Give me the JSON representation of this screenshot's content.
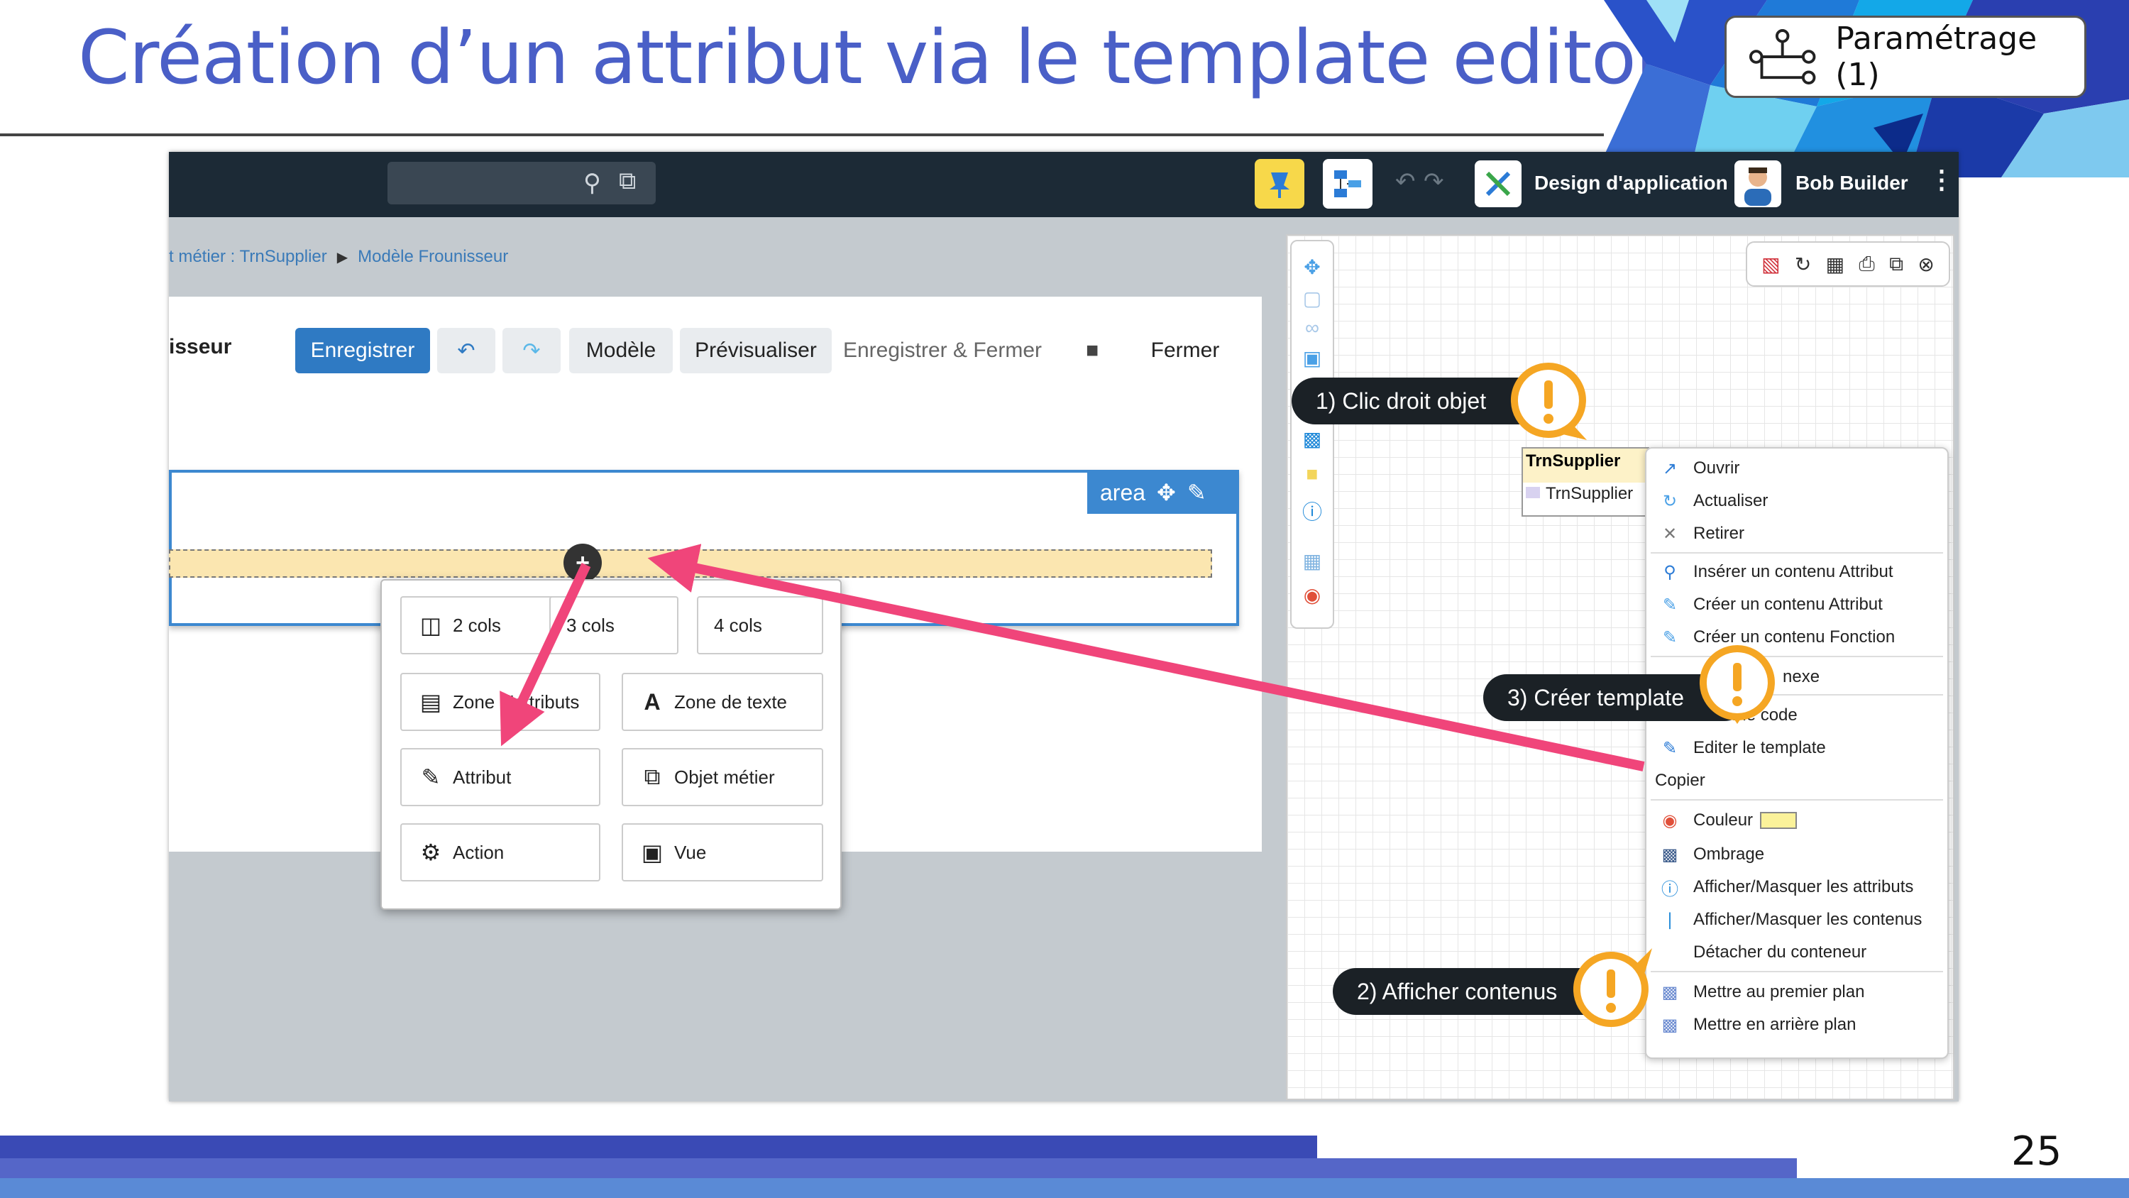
{
  "slide": {
    "title": "Création d’un attribut via le template editor",
    "badge_label": "Paramétrage (1)",
    "page_number": "25"
  },
  "app": {
    "topbar": {
      "app_label": "Design d'application",
      "user_name": "Bob Builder"
    },
    "breadcrumb": {
      "part1": "t métier : TrnSupplier",
      "separator": "▶",
      "part2": "Modèle Frounisseur"
    },
    "header_title": "isseur",
    "toolbar": {
      "save": "Enregistrer",
      "model": "Modèle",
      "preview": "Prévisualiser",
      "save_close": "Enregistrer & Fermer",
      "close": "Fermer"
    },
    "area_label": "area",
    "popup": {
      "items": [
        "2 cols",
        "3 cols",
        "4 cols",
        "Zone d'attributs",
        "Zone de texte",
        "Attribut",
        "Objet métier",
        "Action",
        "Vue"
      ],
      "visible": {
        "c2": "2 cols",
        "c3": "3 cols",
        "c4": "4 cols",
        "zone_attr": "Zone d'attributs",
        "zone_texte": "Zone de texte",
        "attribut": "Attribut",
        "objet": "Objet métier",
        "action": "Action",
        "vue": "Vue"
      }
    },
    "object": {
      "title": "TrnSupplier",
      "row": "TrnSupplier"
    },
    "context_menu": {
      "ouvrir": "Ouvrir",
      "actualiser": "Actualiser",
      "retirer": "Retirer",
      "inserer_attr": "Insérer un contenu Attribut",
      "creer_attr": "Créer un contenu Attribut",
      "creer_fn": "Créer un contenu Fonction",
      "annexe": "nexe",
      "editer_code": "Editer le code",
      "editer_template": "Editer le template",
      "copier": "Copier",
      "couleur": "Couleur",
      "ombrage": "Ombrage",
      "afficher_attr": "Afficher/Masquer les attributs",
      "afficher_contenus": "Afficher/Masquer les contenus",
      "detacher": "Détacher du conteneur",
      "premier_plan": "Mettre au premier plan",
      "arriere_plan": "Mettre en arrière plan"
    },
    "annotations": {
      "step1": "1) Clic droit objet",
      "step2": "2) Afficher contenus",
      "step3": "3) Créer template"
    }
  },
  "colors": {
    "title": "#4a5fc7",
    "accent": "#2f7ac3",
    "arrow": "#f0457a",
    "warning": "#f5a623"
  }
}
